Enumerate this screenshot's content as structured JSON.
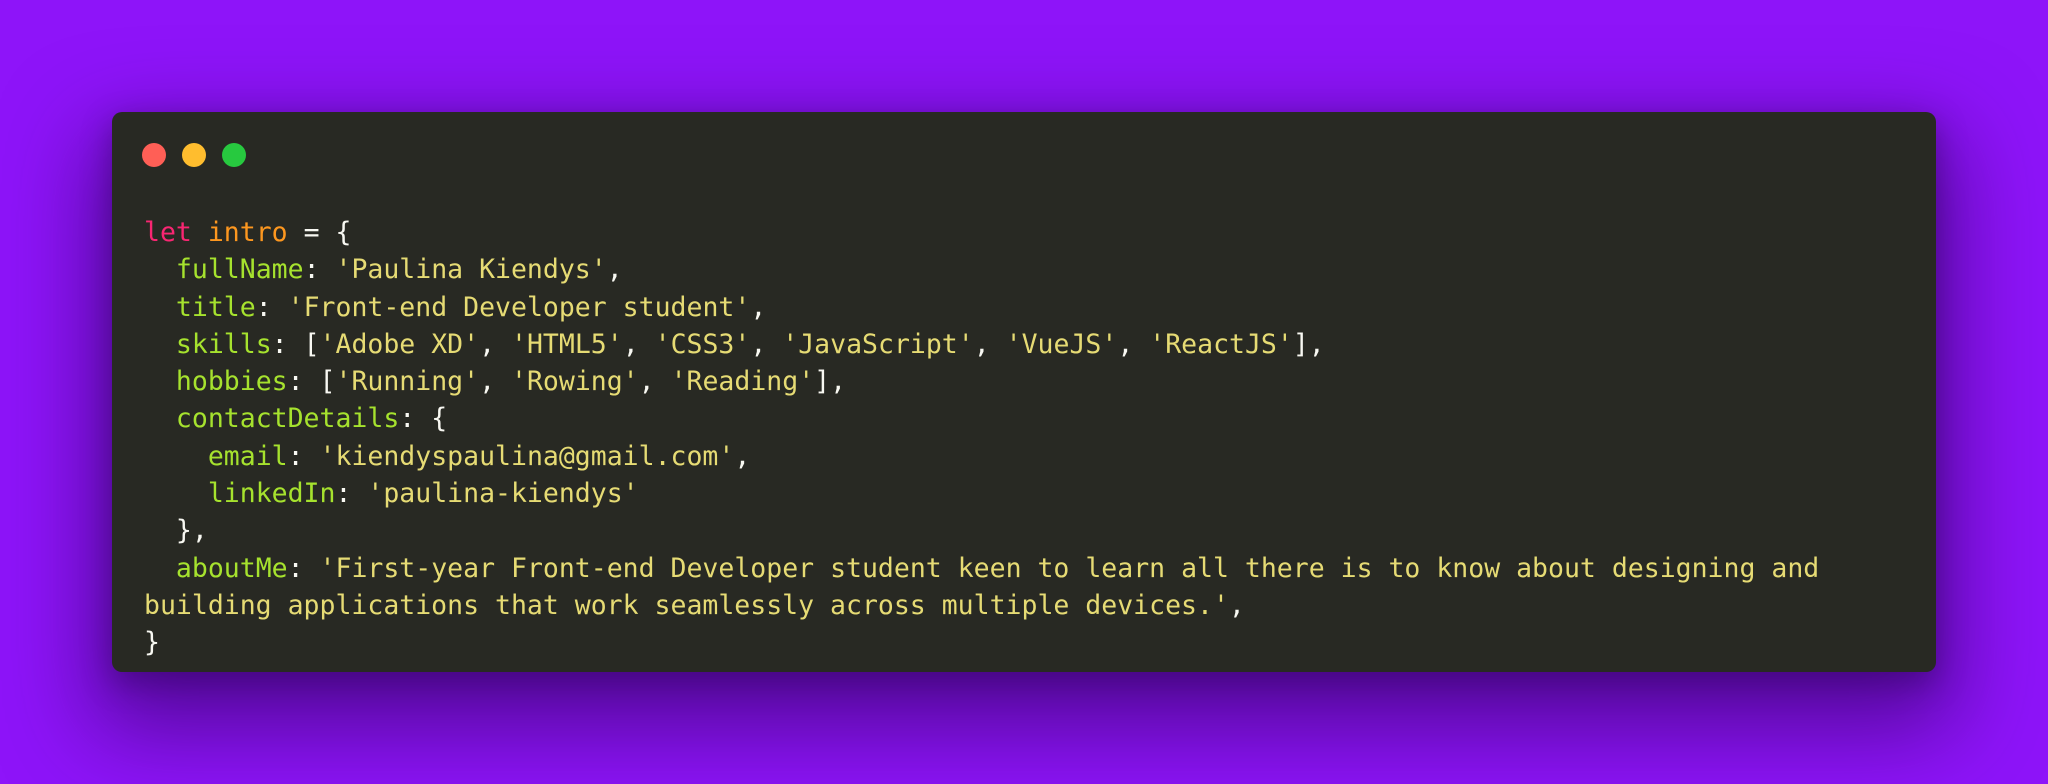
{
  "window": {
    "controls": [
      {
        "name": "close",
        "color": "#ff5f56"
      },
      {
        "name": "minimize",
        "color": "#ffbd2e"
      },
      {
        "name": "maximize",
        "color": "#27c93f"
      }
    ]
  },
  "colors": {
    "background": "#8e14f9",
    "editor_background": "#282923",
    "keyword": "#f92672",
    "variable": "#fd971f",
    "property": "#a6e22e",
    "string": "#e6db74",
    "text": "#f8f8f2"
  },
  "code": {
    "keyword": "let",
    "var_name": "intro",
    "assign_open": " = {",
    "fullName": {
      "key": "fullName",
      "value": "'Paulina Kiendys'"
    },
    "title": {
      "key": "title",
      "value": "'Front-end Developer student'"
    },
    "skills": {
      "key": "skills",
      "values": [
        "'Adobe XD'",
        "'HTML5'",
        "'CSS3'",
        "'JavaScript'",
        "'VueJS'",
        "'ReactJS'"
      ]
    },
    "hobbies": {
      "key": "hobbies",
      "values": [
        "'Running'",
        "'Rowing'",
        "'Reading'"
      ]
    },
    "contactDetails": {
      "key": "contactDetails",
      "email": {
        "key": "email",
        "value": "'kiendyspaulina@gmail.com'"
      },
      "linkedIn": {
        "key": "linkedIn",
        "value": "'paulina-kiendys'"
      }
    },
    "aboutMe": {
      "key": "aboutMe",
      "value_line1": "'First-year Front-end Developer student keen to learn all there is to know about designing and",
      "value_line2": "building applications that work seamlessly across multiple devices.'"
    },
    "close": "}"
  }
}
